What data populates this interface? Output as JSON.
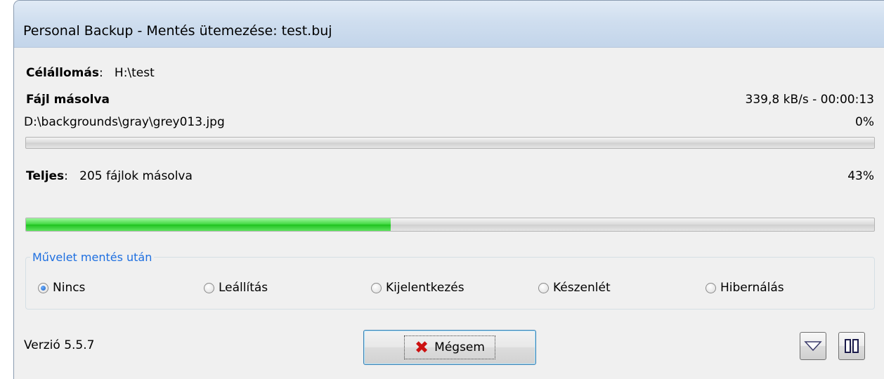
{
  "window": {
    "title": "Personal Backup - Mentés ütemezése: test.buj"
  },
  "destination": {
    "label": "Célállomás",
    "separator": ":",
    "value": "H:\\test"
  },
  "file": {
    "heading": "Fájl másolva",
    "speed_time": "339,8 kB/s - 00:00:13",
    "path": "D:\\backgrounds\\gray\\grey013.jpg",
    "percent_text": "0%",
    "progress_fraction": 0.0
  },
  "total": {
    "label": "Teljes",
    "separator": ":",
    "value": "205 fájlok másolva",
    "percent_text": "43%",
    "progress_fraction": 0.43
  },
  "after_backup": {
    "legend": "Művelet mentés után",
    "options": [
      {
        "label": "Nincs",
        "selected": true
      },
      {
        "label": "Leállítás",
        "selected": false
      },
      {
        "label": "Kijelentkezés",
        "selected": false
      },
      {
        "label": "Készenlét",
        "selected": false
      },
      {
        "label": "Hibernálás",
        "selected": false
      }
    ]
  },
  "footer": {
    "version": "Verzió 5.5.7",
    "cancel_label": "Mégsem",
    "cancel_icon": "close-x-icon",
    "collapse_icon": "triangle-down-icon",
    "pause_icon": "pause-icon"
  },
  "colors": {
    "accent": "#1e6fe0",
    "progress_green": "#2ecc2e",
    "cancel_x": "#cc1111",
    "titlebar": "#cfdeef"
  }
}
